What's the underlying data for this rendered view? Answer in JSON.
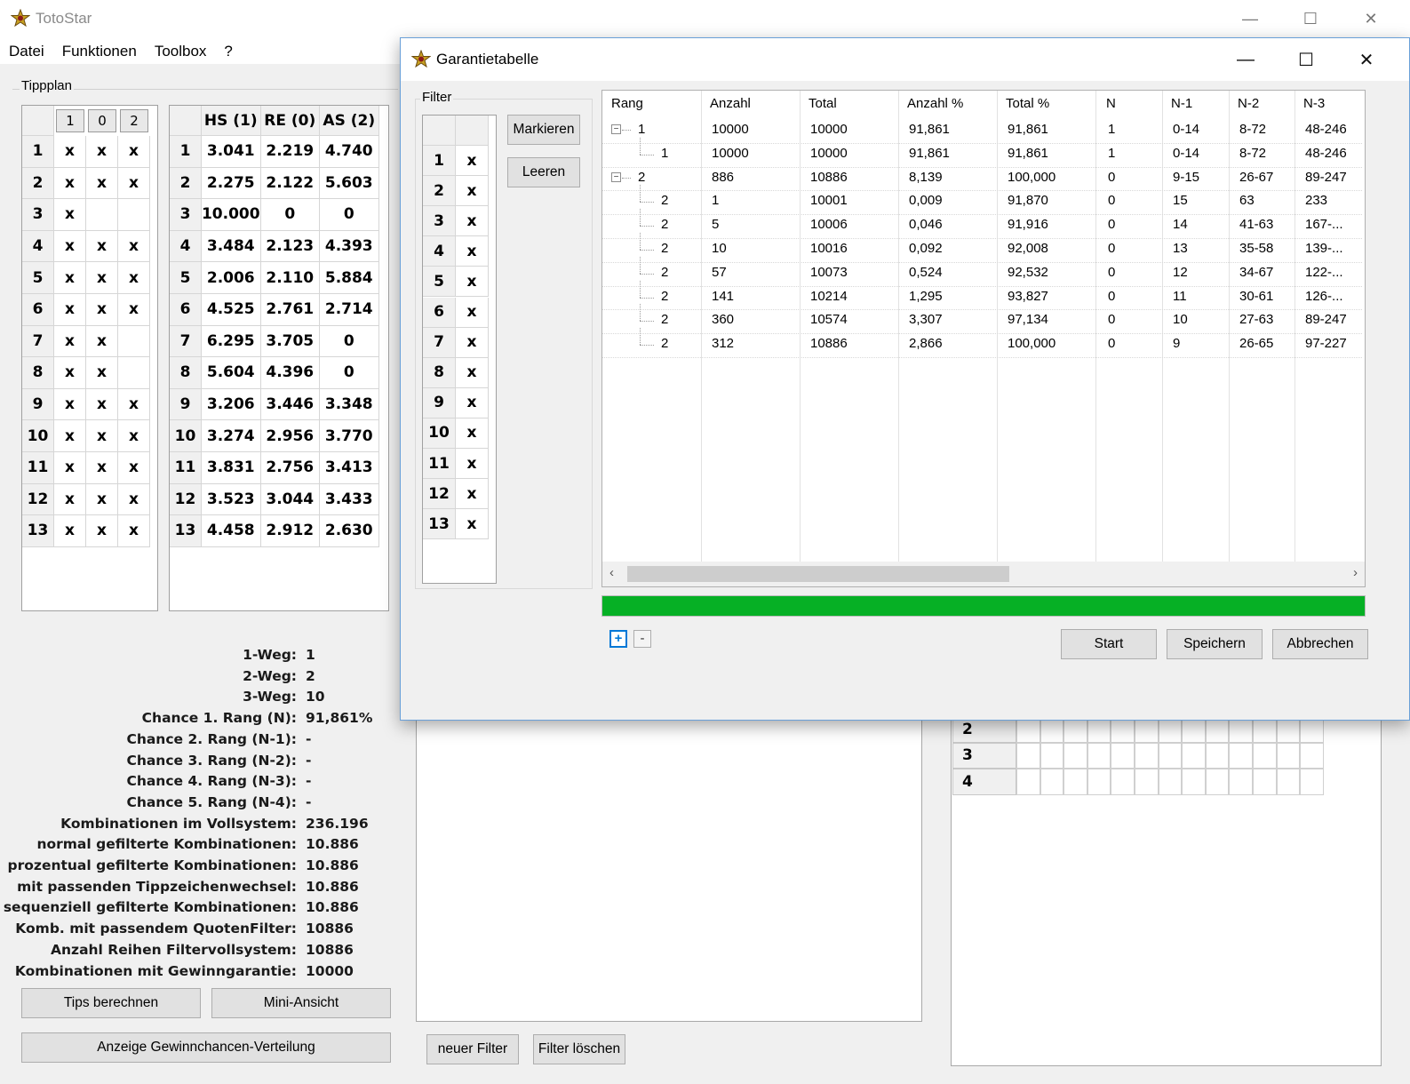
{
  "app": {
    "title": "TotoStar"
  },
  "window_controls": {
    "minimize": "—",
    "maximize": "☐",
    "close": "✕"
  },
  "menu": [
    "Datei",
    "Funktionen",
    "Toolbox",
    "?"
  ],
  "tippplan": {
    "label": "Tippplan",
    "tip_headers": [
      "1",
      "0",
      "2"
    ],
    "tips": [
      [
        "x",
        "x",
        "x"
      ],
      [
        "x",
        "x",
        "x"
      ],
      [
        "x",
        "",
        ""
      ],
      [
        "x",
        "x",
        "x"
      ],
      [
        "x",
        "x",
        "x"
      ],
      [
        "x",
        "x",
        "x"
      ],
      [
        "x",
        "x",
        ""
      ],
      [
        "x",
        "x",
        ""
      ],
      [
        "x",
        "x",
        "x"
      ],
      [
        "x",
        "x",
        "x"
      ],
      [
        "x",
        "x",
        "x"
      ],
      [
        "x",
        "x",
        "x"
      ],
      [
        "x",
        "x",
        "x"
      ]
    ],
    "odds_headers": [
      "HS (1)",
      "RE (0)",
      "AS (2)"
    ],
    "odds": [
      [
        "3.041",
        "2.219",
        "4.740"
      ],
      [
        "2.275",
        "2.122",
        "5.603"
      ],
      [
        "10.000",
        "0",
        "0"
      ],
      [
        "3.484",
        "2.123",
        "4.393"
      ],
      [
        "2.006",
        "2.110",
        "5.884"
      ],
      [
        "4.525",
        "2.761",
        "2.714"
      ],
      [
        "6.295",
        "3.705",
        "0"
      ],
      [
        "5.604",
        "4.396",
        "0"
      ],
      [
        "3.206",
        "3.446",
        "3.348"
      ],
      [
        "3.274",
        "2.956",
        "3.770"
      ],
      [
        "3.831",
        "2.756",
        "3.413"
      ],
      [
        "3.523",
        "3.044",
        "3.433"
      ],
      [
        "4.458",
        "2.912",
        "2.630"
      ]
    ]
  },
  "stats": [
    {
      "label": "1-Weg:",
      "value": "1"
    },
    {
      "label": "2-Weg:",
      "value": "2"
    },
    {
      "label": "3-Weg:",
      "value": "10"
    },
    {
      "label": "Chance 1. Rang (N):",
      "value": "91,861%"
    },
    {
      "label": "Chance 2. Rang (N-1):",
      "value": "-"
    },
    {
      "label": "Chance 3. Rang (N-2):",
      "value": "-"
    },
    {
      "label": "Chance 4. Rang (N-3):",
      "value": "-"
    },
    {
      "label": "Chance 5. Rang (N-4):",
      "value": "-"
    },
    {
      "label": "Kombinationen im Vollsystem:",
      "value": "236.196"
    },
    {
      "label": "normal gefilterte Kombinationen:",
      "value": "10.886"
    },
    {
      "label": "prozentual gefilterte Kombinationen:",
      "value": "10.886"
    },
    {
      "label": "mit passenden Tippzeichenwechsel:",
      "value": "10.886"
    },
    {
      "label": "sequenziell gefilterte Kombinationen:",
      "value": "10.886"
    },
    {
      "label": "Komb. mit passendem QuotenFilter:",
      "value": "10886"
    },
    {
      "label": "Anzahl Reihen Filtervollsystem:",
      "value": "10886"
    },
    {
      "label": "Kombinationen mit Gewinngarantie:",
      "value": "10000"
    }
  ],
  "buttons": {
    "tips_berechnen": "Tips berechnen",
    "mini_ansicht": "Mini-Ansicht",
    "gewinnchancen": "Anzeige Gewinnchancen-Verteilung",
    "neuer_filter": "neuer Filter",
    "filter_loeschen": "Filter löschen"
  },
  "right_grid_rows": [
    "2",
    "3",
    "4"
  ],
  "dialog": {
    "title": "Garantietabelle",
    "filter_label": "Filter",
    "filter_rows": [
      "1",
      "2",
      "3",
      "4",
      "5",
      "6",
      "7",
      "8",
      "9",
      "10",
      "11",
      "12",
      "13"
    ],
    "filter_mark": "x",
    "markieren": "Markieren",
    "leeren": "Leeren",
    "columns": [
      "Rang",
      "Anzahl",
      "Total",
      "Anzahl %",
      "Total %",
      "N",
      "N-1",
      "N-2",
      "N-3"
    ],
    "rows": [
      [
        "1",
        "10000",
        "10000",
        "91,861",
        "91,861",
        "1",
        "0-14",
        "8-72",
        "48-246"
      ],
      [
        "1",
        "10000",
        "10000",
        "91,861",
        "91,861",
        "1",
        "0-14",
        "8-72",
        "48-246"
      ],
      [
        "2",
        "886",
        "10886",
        "8,139",
        "100,000",
        "0",
        "9-15",
        "26-67",
        "89-247"
      ],
      [
        "2",
        "1",
        "10001",
        "0,009",
        "91,870",
        "0",
        "15",
        "63",
        "233"
      ],
      [
        "2",
        "5",
        "10006",
        "0,046",
        "91,916",
        "0",
        "14",
        "41-63",
        "167-..."
      ],
      [
        "2",
        "10",
        "10016",
        "0,092",
        "92,008",
        "0",
        "13",
        "35-58",
        "139-..."
      ],
      [
        "2",
        "57",
        "10073",
        "0,524",
        "92,532",
        "0",
        "12",
        "34-67",
        "122-..."
      ],
      [
        "2",
        "141",
        "10214",
        "1,295",
        "93,827",
        "0",
        "11",
        "30-61",
        "126-..."
      ],
      [
        "2",
        "360",
        "10574",
        "3,307",
        "97,134",
        "0",
        "10",
        "27-63",
        "89-247"
      ],
      [
        "2",
        "312",
        "10886",
        "2,866",
        "100,000",
        "0",
        "9",
        "26-65",
        "97-227"
      ]
    ],
    "row_levels": [
      0,
      1,
      0,
      1,
      1,
      1,
      1,
      1,
      1,
      1
    ],
    "progress": 1.0,
    "expand_all": "+",
    "collapse_all": "-",
    "start": "Start",
    "speichern": "Speichern",
    "abbrechen": "Abbrechen"
  },
  "colors": {
    "progress": "#06b025",
    "dialog_border": "#6aa0d8",
    "accent": "#0078d7"
  }
}
